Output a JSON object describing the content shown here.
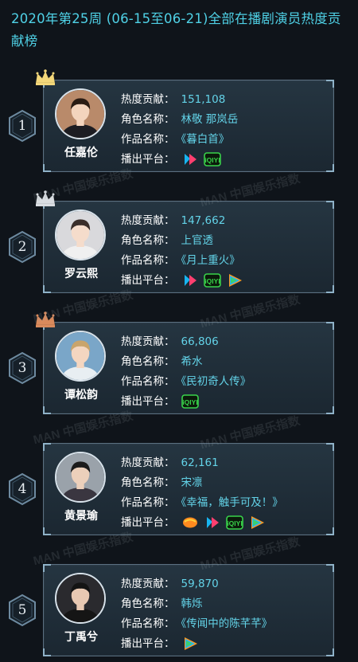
{
  "title": "2020年第25周 (06-15至06-21)全部在播剧演员热度贡献榜",
  "labels": {
    "heat": "热度贡献：",
    "role": "角色名称：",
    "work": "作品名称：",
    "platform": "播出平台："
  },
  "watermark": "MAN 中国娱乐指数",
  "colors": {
    "accent": "#4fd1e6",
    "value": "#63d3e8",
    "crown_gold": "#f3d77a",
    "crown_silver": "#d9dde2",
    "crown_bronze": "#d98a5c"
  },
  "entries": [
    {
      "rank": "1",
      "crown": "gold",
      "name": "任嘉伦",
      "heat": "151,108",
      "role": "林敬 那岚岳",
      "work": "《暮白首》",
      "platforms": [
        "youku-icon",
        "iqiyi-icon"
      ]
    },
    {
      "rank": "2",
      "crown": "silver",
      "name": "罗云熙",
      "heat": "147,662",
      "role": "上官透",
      "work": "《月上重火》",
      "platforms": [
        "youku-icon",
        "iqiyi-icon",
        "tencent-video-icon"
      ]
    },
    {
      "rank": "3",
      "crown": "bronze",
      "name": "谭松韵",
      "heat": "66,806",
      "role": "希水",
      "work": "《民初奇人传》",
      "platforms": [
        "iqiyi-icon"
      ]
    },
    {
      "rank": "4",
      "crown": "",
      "name": "黄景瑜",
      "heat": "62,161",
      "role": "宋凛",
      "work": "《幸福，触手可及！》",
      "platforms": [
        "mango-tv-icon",
        "youku-icon",
        "iqiyi-icon",
        "tencent-video-icon"
      ]
    },
    {
      "rank": "5",
      "crown": "",
      "name": "丁禹兮",
      "heat": "59,870",
      "role": "韩烁",
      "work": "《传闻中的陈芊芊》",
      "platforms": [
        "tencent-video-icon"
      ]
    }
  ]
}
